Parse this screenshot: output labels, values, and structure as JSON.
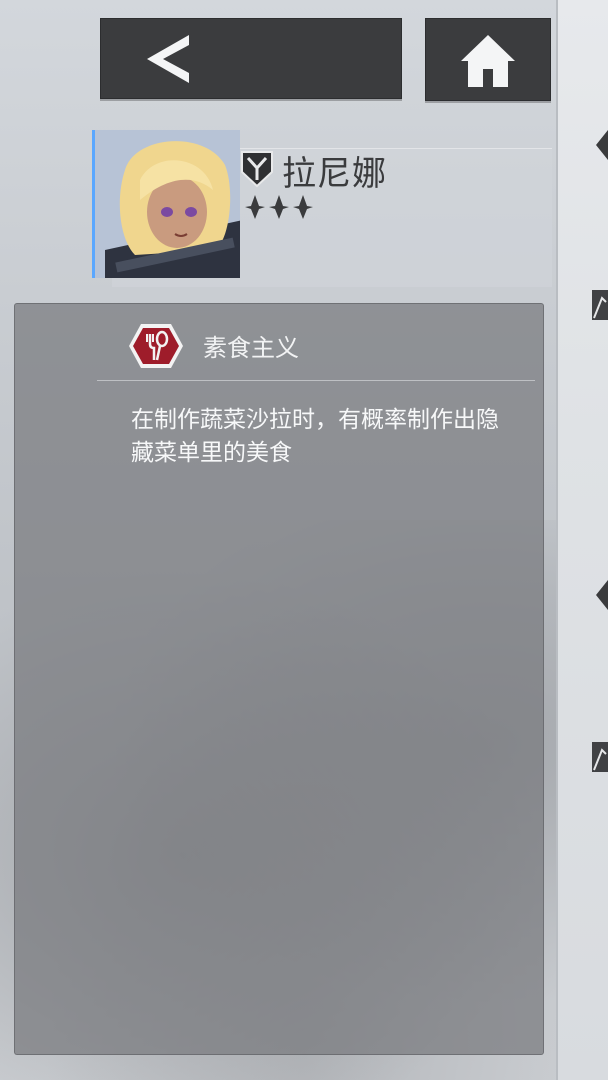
{
  "character": {
    "name": "拉尼娜",
    "faction_icon": "faction-emblem-icon",
    "stars": 3
  },
  "skill": {
    "title": "素食主义",
    "icon": "fork-spoon-hex-icon",
    "description": "在制作蔬菜沙拉时，有概率制作出隐藏菜单里的美食"
  },
  "nav": {
    "back_icon": "back-arrow-icon",
    "home_icon": "home-icon"
  },
  "colors": {
    "button_bg": "#3b3c3e",
    "skill_icon_red": "#9e1c2a",
    "portrait_accent": "#5aa7ff"
  }
}
